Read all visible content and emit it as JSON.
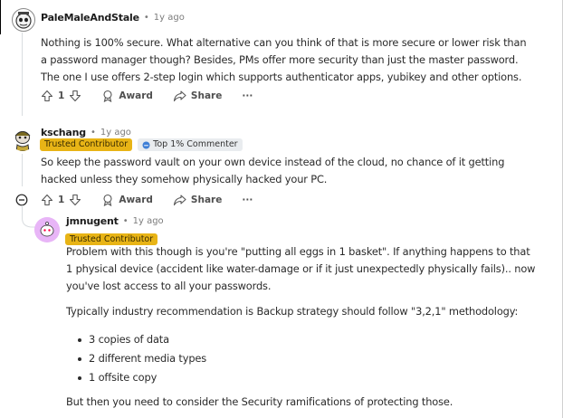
{
  "comments": [
    {
      "username": "PaleMaleAndStale",
      "age": "1y ago",
      "body": "Nothing is 100% secure. What alternative can you think of that is more secure or lower risk than a password manager though? Besides, PMs offer more security than just the master password. The one I use offers 2-step login which supports authenticator apps, yubikey and other options.",
      "votes": "1",
      "award_label": "Award",
      "share_label": "Share",
      "more_label": "···"
    },
    {
      "username": "kschang",
      "age": "1y ago",
      "flair_trusted": "Trusted Contributor",
      "flair_top": "Top 1% Commenter",
      "body": "So keep the password vault on your own device instead of the cloud, no chance of it getting hacked unless they somehow physically hacked your PC.",
      "votes": "1",
      "award_label": "Award",
      "share_label": "Share",
      "more_label": "···",
      "collapse_label": "⊖"
    },
    {
      "username": "jmnugent",
      "age": "1y ago",
      "flair_trusted": "Trusted Contributor",
      "paragraph1": "Problem with this though is you're \"putting all eggs in 1 basket\". If anything happens to that 1 physical device (accident like water-damage or if it just unexpectedly physically fails).. now you've lost access to all your passwords.",
      "paragraph2": "Typically industry recommendation is Backup strategy should follow \"3,2,1\" methodology:",
      "bullets": [
        "3 copies of data",
        "2 different media types",
        "1 offsite copy"
      ],
      "paragraph3": "But then you need to consider the Security ramifications of protecting those."
    }
  ],
  "separator": "•",
  "colors": {
    "flair_trusted": "#e8b416",
    "text": "#2a2a2a",
    "meta": "#7c7c7c"
  }
}
